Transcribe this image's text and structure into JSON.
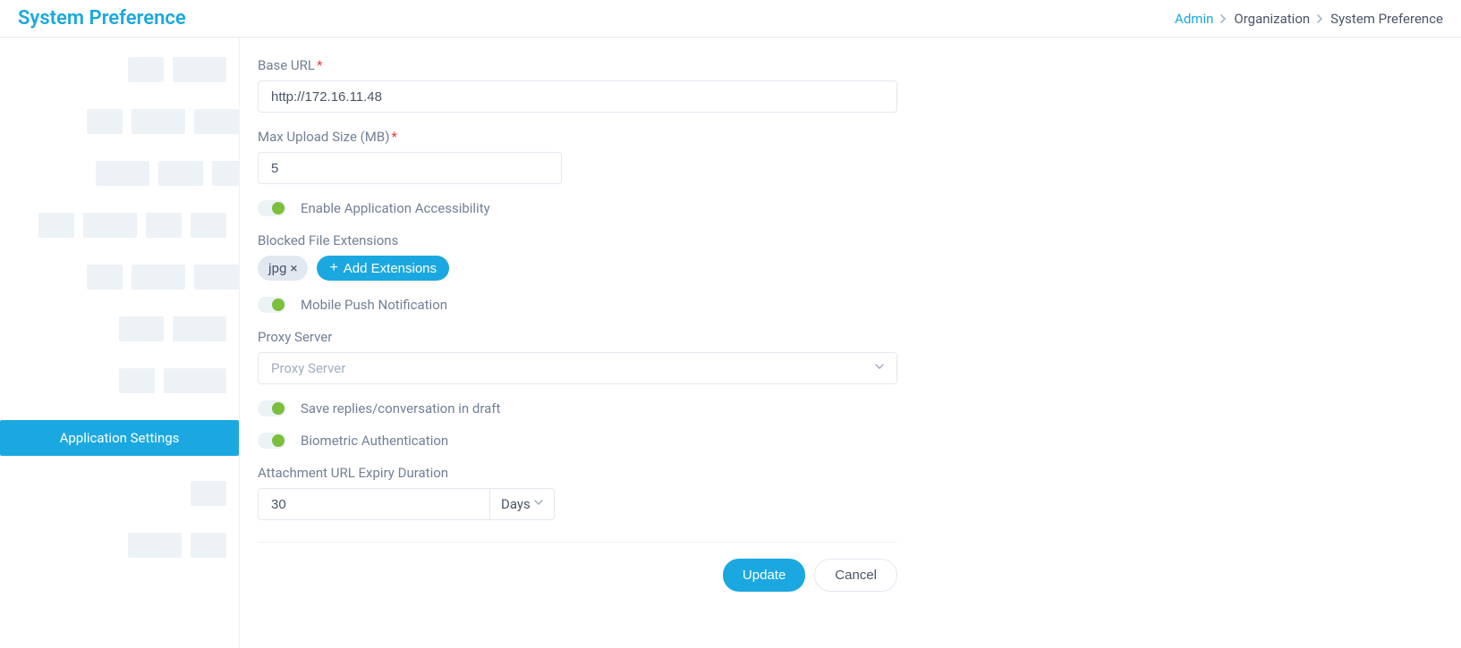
{
  "header": {
    "title": "System Preference"
  },
  "breadcrumb": {
    "admin": "Admin",
    "organization": "Organization",
    "system_preference": "System Preference"
  },
  "sidebar": {
    "active_label": "Application Settings"
  },
  "form": {
    "base_url": {
      "label": "Base URL",
      "value": "http://172.16.11.48"
    },
    "max_upload": {
      "label": "Max Upload Size (MB)",
      "value": "5"
    },
    "enable_accessibility": {
      "label": "Enable Application Accessibility"
    },
    "blocked_ext": {
      "label": "Blocked File Extensions",
      "tag": "jpg",
      "add_label": "Add Extensions"
    },
    "mobile_push": {
      "label": "Mobile Push Notification"
    },
    "proxy": {
      "label": "Proxy Server",
      "placeholder": "Proxy Server"
    },
    "save_draft": {
      "label": "Save replies/conversation in draft"
    },
    "biometric": {
      "label": "Biometric Authentication"
    },
    "attachment_expiry": {
      "label": "Attachment URL Expiry Duration",
      "value": "30",
      "unit": "Days"
    },
    "actions": {
      "update": "Update",
      "cancel": "Cancel"
    }
  }
}
